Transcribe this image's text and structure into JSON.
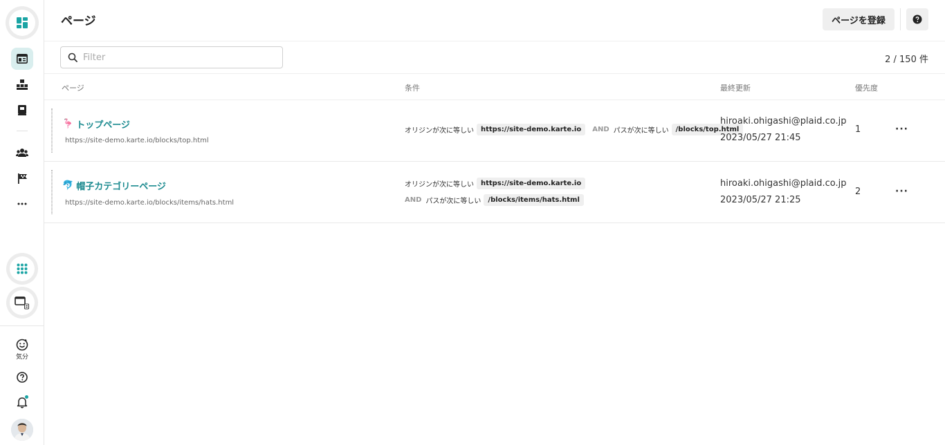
{
  "sidebar": {
    "mood_label": "気分"
  },
  "header": {
    "title": "ページ",
    "register_label": "ページを登録"
  },
  "filter": {
    "placeholder": "Filter",
    "value": ""
  },
  "count_text": "2 / 150 件",
  "columns": {
    "page": "ページ",
    "condition": "条件",
    "updated": "最終更新",
    "priority": "優先度"
  },
  "rows": [
    {
      "emoji": "🦩",
      "name": "トップページ",
      "url": "https://site-demo.karte.io/blocks/top.html",
      "cond1_label": "オリジンが次に等しい",
      "cond1_value": "https://site-demo.karte.io",
      "and": "AND",
      "cond2_label": "パスが次に等しい",
      "cond2_value": "/blocks/top.html",
      "user": "hiroaki.ohigashi@plaid.co.jp",
      "date": "2023/05/27 21:45",
      "priority": "1",
      "more": "···"
    },
    {
      "emoji": "🐬",
      "name": "帽子カテゴリーページ",
      "url": "https://site-demo.karte.io/blocks/items/hats.html",
      "cond1_label": "オリジンが次に等しい",
      "cond1_value": "https://site-demo.karte.io",
      "and": "AND",
      "cond2_label": "パスが次に等しい",
      "cond2_value": "/blocks/items/hats.html",
      "user": "hiroaki.ohigashi@plaid.co.jp",
      "date": "2023/05/27 21:25",
      "priority": "2",
      "more": "···"
    }
  ],
  "colors": {
    "accent": "#1b8a8f",
    "brand_teal": "#1aa4a4"
  }
}
